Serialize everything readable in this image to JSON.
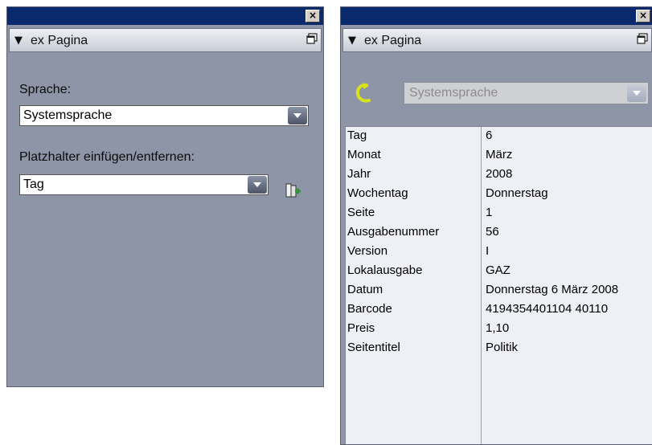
{
  "left_panel": {
    "header_title": "ex Pagina",
    "close_label": "×",
    "language_label": "Sprache:",
    "language_value": "Systemsprache",
    "placeholder_label": "Platzhalter einfügen/entfernen:",
    "placeholder_value": "Tag"
  },
  "right_panel": {
    "header_title": "ex Pagina",
    "close_label": "×",
    "language_value": "Systemsprache",
    "rows": [
      {
        "key": "Tag",
        "value": "6"
      },
      {
        "key": "Monat",
        "value": "März"
      },
      {
        "key": "Jahr",
        "value": "2008"
      },
      {
        "key": "Wochentag",
        "value": "Donnerstag"
      },
      {
        "key": "Seite",
        "value": "1"
      },
      {
        "key": "Ausgabenummer",
        "value": "56"
      },
      {
        "key": "Version",
        "value": "I"
      },
      {
        "key": "Lokalausgabe",
        "value": "GAZ"
      },
      {
        "key": "Datum",
        "value": "Donnerstag 6 März 2008"
      },
      {
        "key": "Barcode",
        "value": "4194354401104 40110"
      },
      {
        "key": "Preis",
        "value": "1,10"
      },
      {
        "key": "Seitentitel",
        "value": "Politik"
      }
    ]
  },
  "colors": {
    "titlebar": "#0b2a6e",
    "panel_bg": "#8e95a7",
    "table_bg": "#eef0f5"
  }
}
